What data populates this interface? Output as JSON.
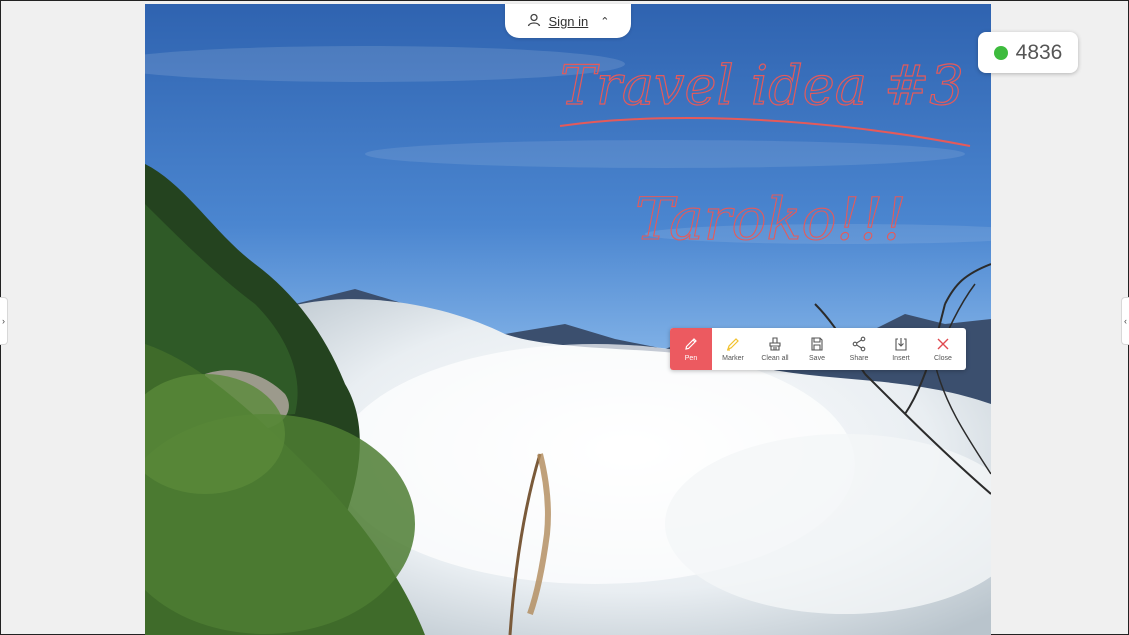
{
  "header": {
    "sign_in_label": "Sign in"
  },
  "counter": {
    "value": "4836",
    "status_color": "#3dbb3d"
  },
  "annotations": {
    "line1": "Travel idea #3",
    "line2": "Taroko!!!"
  },
  "toolbar": {
    "accent_color": "#ec5a60",
    "tools": [
      {
        "label": "Pen",
        "icon": "pen-icon",
        "active": true
      },
      {
        "label": "Marker",
        "icon": "marker-icon",
        "active": false
      },
      {
        "label": "Clean all",
        "icon": "clean-all-icon",
        "active": false
      },
      {
        "label": "Save",
        "icon": "save-icon",
        "active": false
      },
      {
        "label": "Share",
        "icon": "share-icon",
        "active": false
      },
      {
        "label": "Insert",
        "icon": "insert-icon",
        "active": false
      },
      {
        "label": "Close",
        "icon": "close-icon",
        "active": false
      }
    ]
  }
}
